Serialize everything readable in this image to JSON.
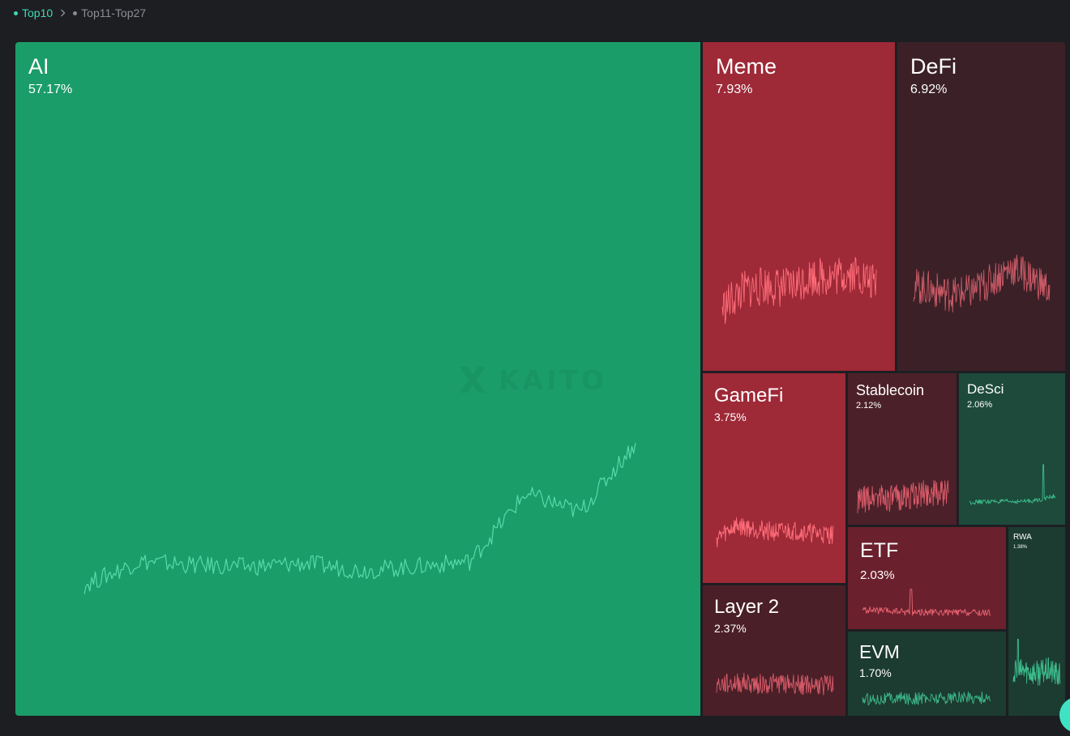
{
  "breadcrumb": {
    "active": "Top10",
    "inactive": "Top11-Top27"
  },
  "watermark": {
    "text": "KAITO"
  },
  "tiles": [
    {
      "key": "ai",
      "name": "AI",
      "percent": "57.17%",
      "color": "#1b9d69",
      "line_color": "#56dba8",
      "trend": "up"
    },
    {
      "key": "meme",
      "name": "Meme",
      "percent": "7.93%",
      "color": "#9e2937",
      "line_color": "#ff6d7a",
      "trend": "down"
    },
    {
      "key": "defi",
      "name": "DeFi",
      "percent": "6.92%",
      "color": "#3b2127",
      "line_color": "#c95a66",
      "trend": "down"
    },
    {
      "key": "gamefi",
      "name": "GameFi",
      "percent": "3.75%",
      "color": "#9e2937",
      "line_color": "#ff6d7a",
      "trend": "down"
    },
    {
      "key": "stablecoin",
      "name": "Stablecoin",
      "percent": "2.12%",
      "color": "#4c2029",
      "line_color": "#d85b69",
      "trend": "down"
    },
    {
      "key": "desci",
      "name": "DeSci",
      "percent": "2.06%",
      "color": "#1d4a3b",
      "line_color": "#3dbb8c",
      "trend": "up"
    },
    {
      "key": "layer2",
      "name": "Layer 2",
      "percent": "2.37%",
      "color": "#4b1f28",
      "line_color": "#d85b69",
      "trend": "down"
    },
    {
      "key": "etf",
      "name": "ETF",
      "percent": "2.03%",
      "color": "#6b212d",
      "line_color": "#f06675",
      "trend": "down"
    },
    {
      "key": "rwa",
      "name": "RWA",
      "percent": "1.38%",
      "color": "#1c3b31",
      "line_color": "#3dbb8c",
      "trend": "up"
    },
    {
      "key": "evm",
      "name": "EVM",
      "percent": "1.70%",
      "color": "#1c3b31",
      "line_color": "#3dbb8c",
      "trend": "up"
    }
  ]
}
